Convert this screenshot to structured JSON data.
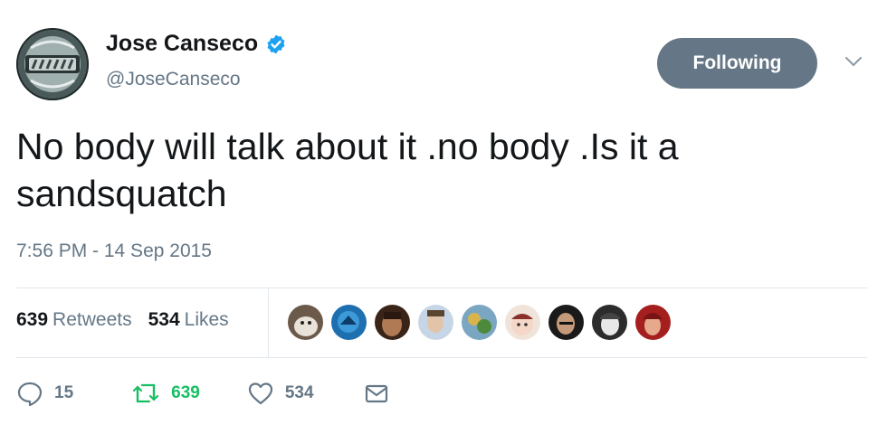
{
  "tweet": {
    "author_name": "Jose Canseco",
    "author_handle": "@JoseCanseco",
    "verified": true,
    "follow_button_label": "Following",
    "text": "No body will talk about it .no body .Is it a sandsquatch",
    "timestamp": "7:56 PM - 14 Sep 2015",
    "stats": {
      "retweets_count": "639",
      "retweets_label": "Retweets",
      "likes_count": "534",
      "likes_label": "Likes"
    },
    "actions": {
      "reply_count": "15",
      "retweet_count": "639",
      "like_count": "534"
    }
  },
  "colors": {
    "text_primary": "#14171a",
    "text_secondary": "#657786",
    "verified_blue": "#1da1f2",
    "retweet_green": "#17bf63",
    "follow_button_bg": "#657786",
    "divider": "#e1e8ed"
  },
  "icons": [
    "avatar-logo",
    "verified-badge-icon",
    "chevron-down-icon",
    "reply-icon",
    "retweet-icon",
    "heart-icon",
    "envelope-icon"
  ]
}
